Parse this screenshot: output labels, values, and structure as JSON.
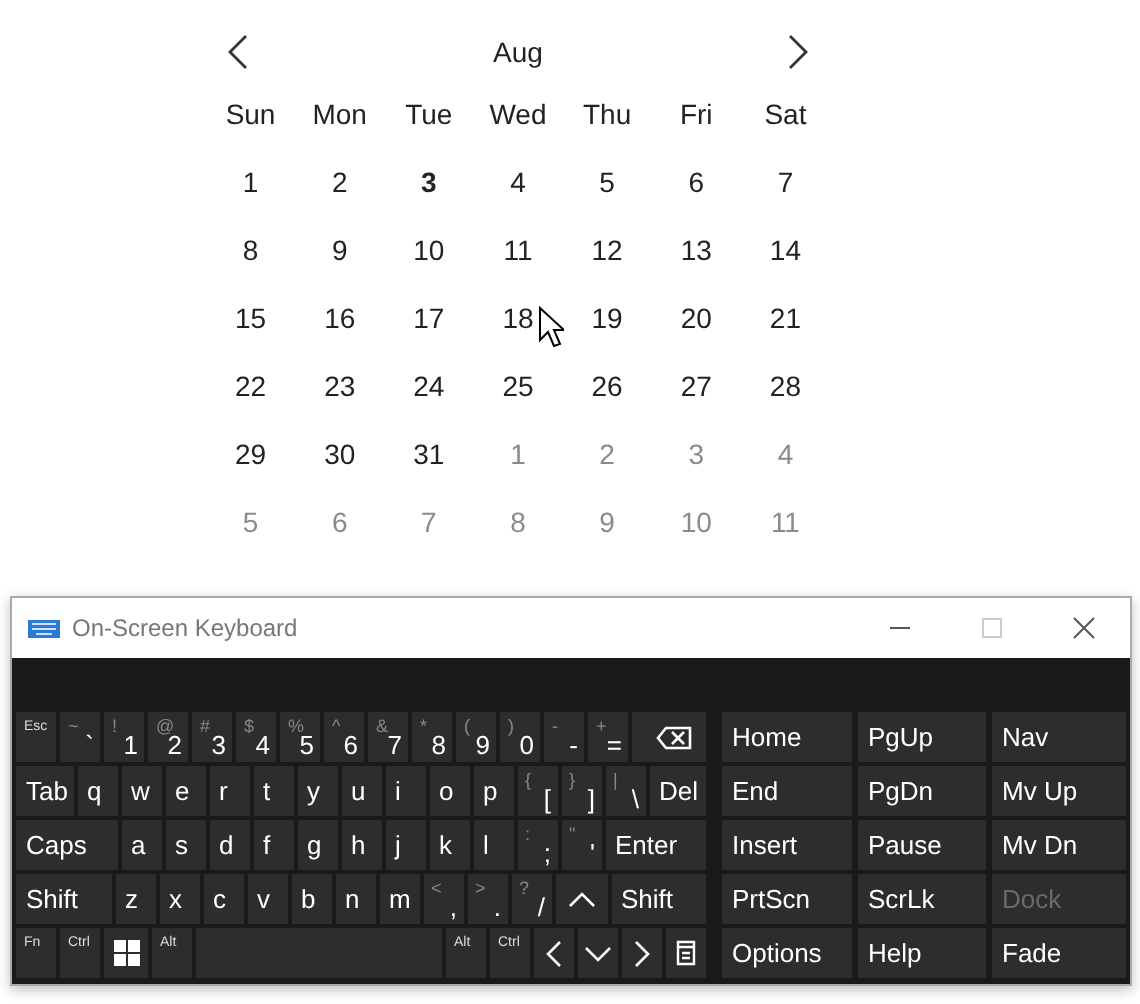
{
  "calendar": {
    "month": "Aug",
    "weekdays": [
      "Sun",
      "Mon",
      "Tue",
      "Wed",
      "Thu",
      "Fri",
      "Sat"
    ],
    "weeks": [
      [
        {
          "day": "1",
          "today": false,
          "outside": false
        },
        {
          "day": "2",
          "today": false,
          "outside": false
        },
        {
          "day": "3",
          "today": true,
          "outside": false
        },
        {
          "day": "4",
          "today": false,
          "outside": false
        },
        {
          "day": "5",
          "today": false,
          "outside": false
        },
        {
          "day": "6",
          "today": false,
          "outside": false
        },
        {
          "day": "7",
          "today": false,
          "outside": false
        }
      ],
      [
        {
          "day": "8",
          "today": false,
          "outside": false
        },
        {
          "day": "9",
          "today": false,
          "outside": false
        },
        {
          "day": "10",
          "today": false,
          "outside": false
        },
        {
          "day": "11",
          "today": false,
          "outside": false
        },
        {
          "day": "12",
          "today": false,
          "outside": false
        },
        {
          "day": "13",
          "today": false,
          "outside": false
        },
        {
          "day": "14",
          "today": false,
          "outside": false
        }
      ],
      [
        {
          "day": "15",
          "today": false,
          "outside": false
        },
        {
          "day": "16",
          "today": false,
          "outside": false
        },
        {
          "day": "17",
          "today": false,
          "outside": false
        },
        {
          "day": "18",
          "today": false,
          "outside": false
        },
        {
          "day": "19",
          "today": false,
          "outside": false
        },
        {
          "day": "20",
          "today": false,
          "outside": false
        },
        {
          "day": "21",
          "today": false,
          "outside": false
        }
      ],
      [
        {
          "day": "22",
          "today": false,
          "outside": false
        },
        {
          "day": "23",
          "today": false,
          "outside": false
        },
        {
          "day": "24",
          "today": false,
          "outside": false
        },
        {
          "day": "25",
          "today": false,
          "outside": false
        },
        {
          "day": "26",
          "today": false,
          "outside": false
        },
        {
          "day": "27",
          "today": false,
          "outside": false
        },
        {
          "day": "28",
          "today": false,
          "outside": false
        }
      ],
      [
        {
          "day": "29",
          "today": false,
          "outside": false
        },
        {
          "day": "30",
          "today": false,
          "outside": false
        },
        {
          "day": "31",
          "today": false,
          "outside": false
        },
        {
          "day": "1",
          "today": false,
          "outside": true
        },
        {
          "day": "2",
          "today": false,
          "outside": true
        },
        {
          "day": "3",
          "today": false,
          "outside": true
        },
        {
          "day": "4",
          "today": false,
          "outside": true
        }
      ],
      [
        {
          "day": "5",
          "today": false,
          "outside": true
        },
        {
          "day": "6",
          "today": false,
          "outside": true
        },
        {
          "day": "7",
          "today": false,
          "outside": true
        },
        {
          "day": "8",
          "today": false,
          "outside": true
        },
        {
          "day": "9",
          "today": false,
          "outside": true
        },
        {
          "day": "10",
          "today": false,
          "outside": true
        },
        {
          "day": "11",
          "today": false,
          "outside": true
        }
      ]
    ]
  },
  "keyboard_window": {
    "title": "On-Screen Keyboard",
    "key_rows": [
      [
        {
          "kind": "tiny",
          "label": "Esc"
        },
        {
          "kind": "symbol",
          "shift": "~",
          "base": "`"
        },
        {
          "kind": "symbol",
          "shift": "!",
          "base": "1"
        },
        {
          "kind": "symbol",
          "shift": "@",
          "base": "2"
        },
        {
          "kind": "symbol",
          "shift": "#",
          "base": "3"
        },
        {
          "kind": "symbol",
          "shift": "$",
          "base": "4"
        },
        {
          "kind": "symbol",
          "shift": "%",
          "base": "5"
        },
        {
          "kind": "symbol",
          "shift": "^",
          "base": "6"
        },
        {
          "kind": "symbol",
          "shift": "&",
          "base": "7"
        },
        {
          "kind": "symbol",
          "shift": "*",
          "base": "8"
        },
        {
          "kind": "symbol",
          "shift": "(",
          "base": "9"
        },
        {
          "kind": "symbol",
          "shift": ")",
          "base": "0"
        },
        {
          "kind": "symbol",
          "shift": "-",
          "base": "-"
        },
        {
          "kind": "symbol",
          "shift": "+",
          "base": "="
        },
        {
          "kind": "backspace"
        }
      ],
      [
        {
          "kind": "function",
          "label": "Tab"
        },
        {
          "kind": "letter",
          "label": "q"
        },
        {
          "kind": "letter",
          "label": "w"
        },
        {
          "kind": "letter",
          "label": "e"
        },
        {
          "kind": "letter",
          "label": "r"
        },
        {
          "kind": "letter",
          "label": "t"
        },
        {
          "kind": "letter",
          "label": "y"
        },
        {
          "kind": "letter",
          "label": "u"
        },
        {
          "kind": "letter",
          "label": "i"
        },
        {
          "kind": "letter",
          "label": "o"
        },
        {
          "kind": "letter",
          "label": "p"
        },
        {
          "kind": "symbol",
          "shift": "{",
          "base": "["
        },
        {
          "kind": "symbol",
          "shift": "}",
          "base": "]"
        },
        {
          "kind": "symbol",
          "shift": "|",
          "base": "\\"
        },
        {
          "kind": "function",
          "label": "Del"
        }
      ],
      [
        {
          "kind": "function",
          "label": "Caps"
        },
        {
          "kind": "letter",
          "label": "a"
        },
        {
          "kind": "letter",
          "label": "s"
        },
        {
          "kind": "letter",
          "label": "d"
        },
        {
          "kind": "letter",
          "label": "f"
        },
        {
          "kind": "letter",
          "label": "g"
        },
        {
          "kind": "letter",
          "label": "h"
        },
        {
          "kind": "letter",
          "label": "j"
        },
        {
          "kind": "letter",
          "label": "k"
        },
        {
          "kind": "letter",
          "label": "l"
        },
        {
          "kind": "symbol",
          "shift": ":",
          "base": ";"
        },
        {
          "kind": "symbol",
          "shift": "\"",
          "base": "'"
        },
        {
          "kind": "function",
          "label": "Enter"
        }
      ],
      [
        {
          "kind": "function",
          "label": "Shift"
        },
        {
          "kind": "letter",
          "label": "z"
        },
        {
          "kind": "letter",
          "label": "x"
        },
        {
          "kind": "letter",
          "label": "c"
        },
        {
          "kind": "letter",
          "label": "v"
        },
        {
          "kind": "letter",
          "label": "b"
        },
        {
          "kind": "letter",
          "label": "n"
        },
        {
          "kind": "letter",
          "label": "m"
        },
        {
          "kind": "symbol",
          "shift": "<",
          "base": ","
        },
        {
          "kind": "symbol",
          "shift": ">",
          "base": "."
        },
        {
          "kind": "symbol",
          "shift": "?",
          "base": "/"
        },
        {
          "kind": "up"
        },
        {
          "kind": "function",
          "label": "Shift"
        }
      ],
      [
        {
          "kind": "tiny",
          "label": "Fn"
        },
        {
          "kind": "tiny",
          "label": "Ctrl"
        },
        {
          "kind": "windows"
        },
        {
          "kind": "tiny",
          "label": "Alt"
        },
        {
          "kind": "space"
        },
        {
          "kind": "tiny",
          "label": "Alt"
        },
        {
          "kind": "tiny",
          "label": "Ctrl"
        },
        {
          "kind": "left"
        },
        {
          "kind": "down"
        },
        {
          "kind": "right"
        },
        {
          "kind": "menu"
        }
      ]
    ],
    "side_rows": [
      [
        {
          "label": "Home",
          "disabled": false
        },
        {
          "label": "PgUp",
          "disabled": false
        },
        {
          "label": "Nav",
          "disabled": false
        }
      ],
      [
        {
          "label": "End",
          "disabled": false
        },
        {
          "label": "PgDn",
          "disabled": false
        },
        {
          "label": "Mv Up",
          "disabled": false
        }
      ],
      [
        {
          "label": "Insert",
          "disabled": false
        },
        {
          "label": "Pause",
          "disabled": false
        },
        {
          "label": "Mv Dn",
          "disabled": false
        }
      ],
      [
        {
          "label": "PrtScn",
          "disabled": false
        },
        {
          "label": "ScrLk",
          "disabled": false
        },
        {
          "label": "Dock",
          "disabled": true
        }
      ],
      [
        {
          "label": "Options",
          "disabled": false
        },
        {
          "label": "Help",
          "disabled": false
        },
        {
          "label": "Fade",
          "disabled": false
        }
      ]
    ]
  }
}
